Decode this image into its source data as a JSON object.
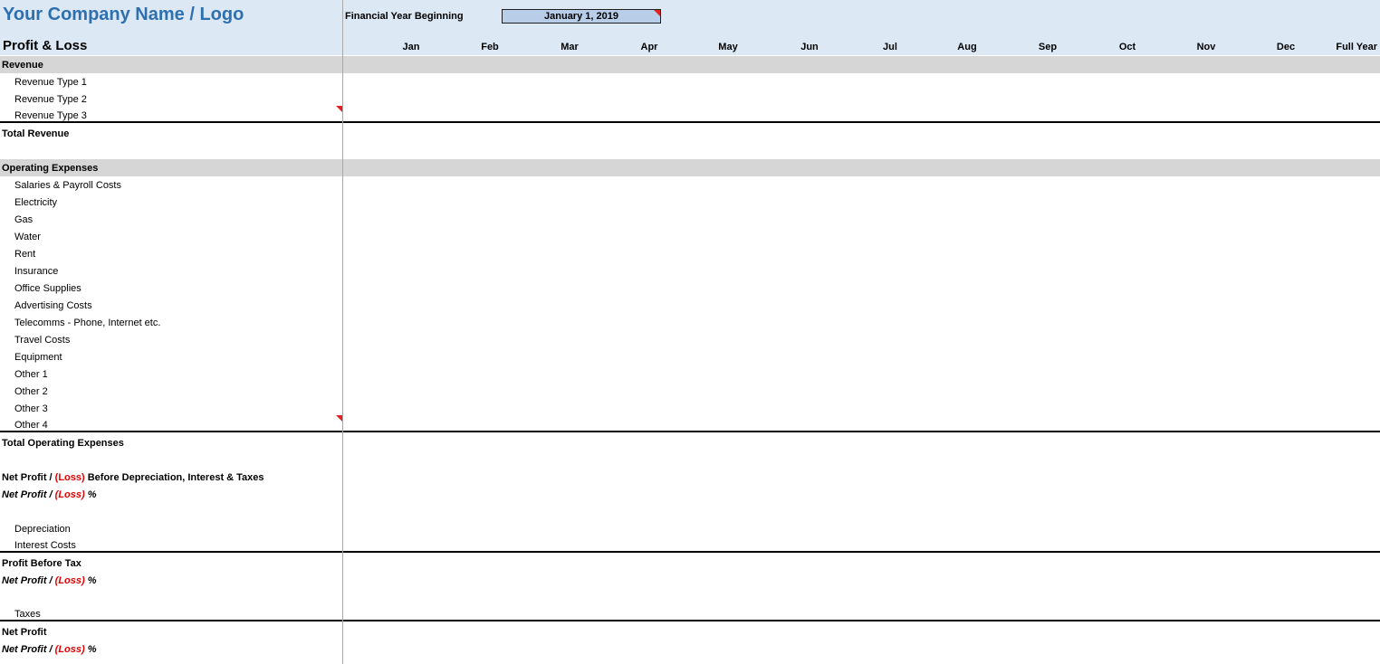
{
  "header": {
    "company": "Your Company Name / Logo",
    "title": "Profit & Loss",
    "fy_label": "Financial Year Beginning",
    "fy_value": "January 1, 2019",
    "months": [
      "Jan",
      "Feb",
      "Mar",
      "Apr",
      "May",
      "Jun",
      "Jul",
      "Aug",
      "Sep",
      "Oct",
      "Nov",
      "Dec"
    ],
    "full_year": "Full Year"
  },
  "sections": {
    "revenue": "Revenue",
    "revenue_items": [
      "Revenue Type 1",
      "Revenue Type 2",
      "Revenue Type 3"
    ],
    "total_revenue": "Total Revenue",
    "opex": "Operating Expenses",
    "opex_items": [
      "Salaries & Payroll Costs",
      "Electricity",
      "Gas",
      "Water",
      "Rent",
      "Insurance",
      "Office Supplies",
      "Advertising Costs",
      "Telecomms - Phone, Internet etc.",
      "Travel Costs",
      "Equipment",
      "Other 1",
      "Other 2",
      "Other 3",
      "Other 4"
    ],
    "total_opex": "Total Operating Expenses",
    "net_before_prefix": "Net Profit / ",
    "loss": "(Loss)",
    "net_before_suffix": " Before Depreciation, Interest & Taxes",
    "pct_prefix": "Net Profit / ",
    "pct_suffix": " %",
    "depreciation": "Depreciation",
    "interest": "Interest Costs",
    "profit_before_tax": "Profit Before Tax",
    "taxes": "Taxes",
    "net_profit": "Net Profit"
  }
}
